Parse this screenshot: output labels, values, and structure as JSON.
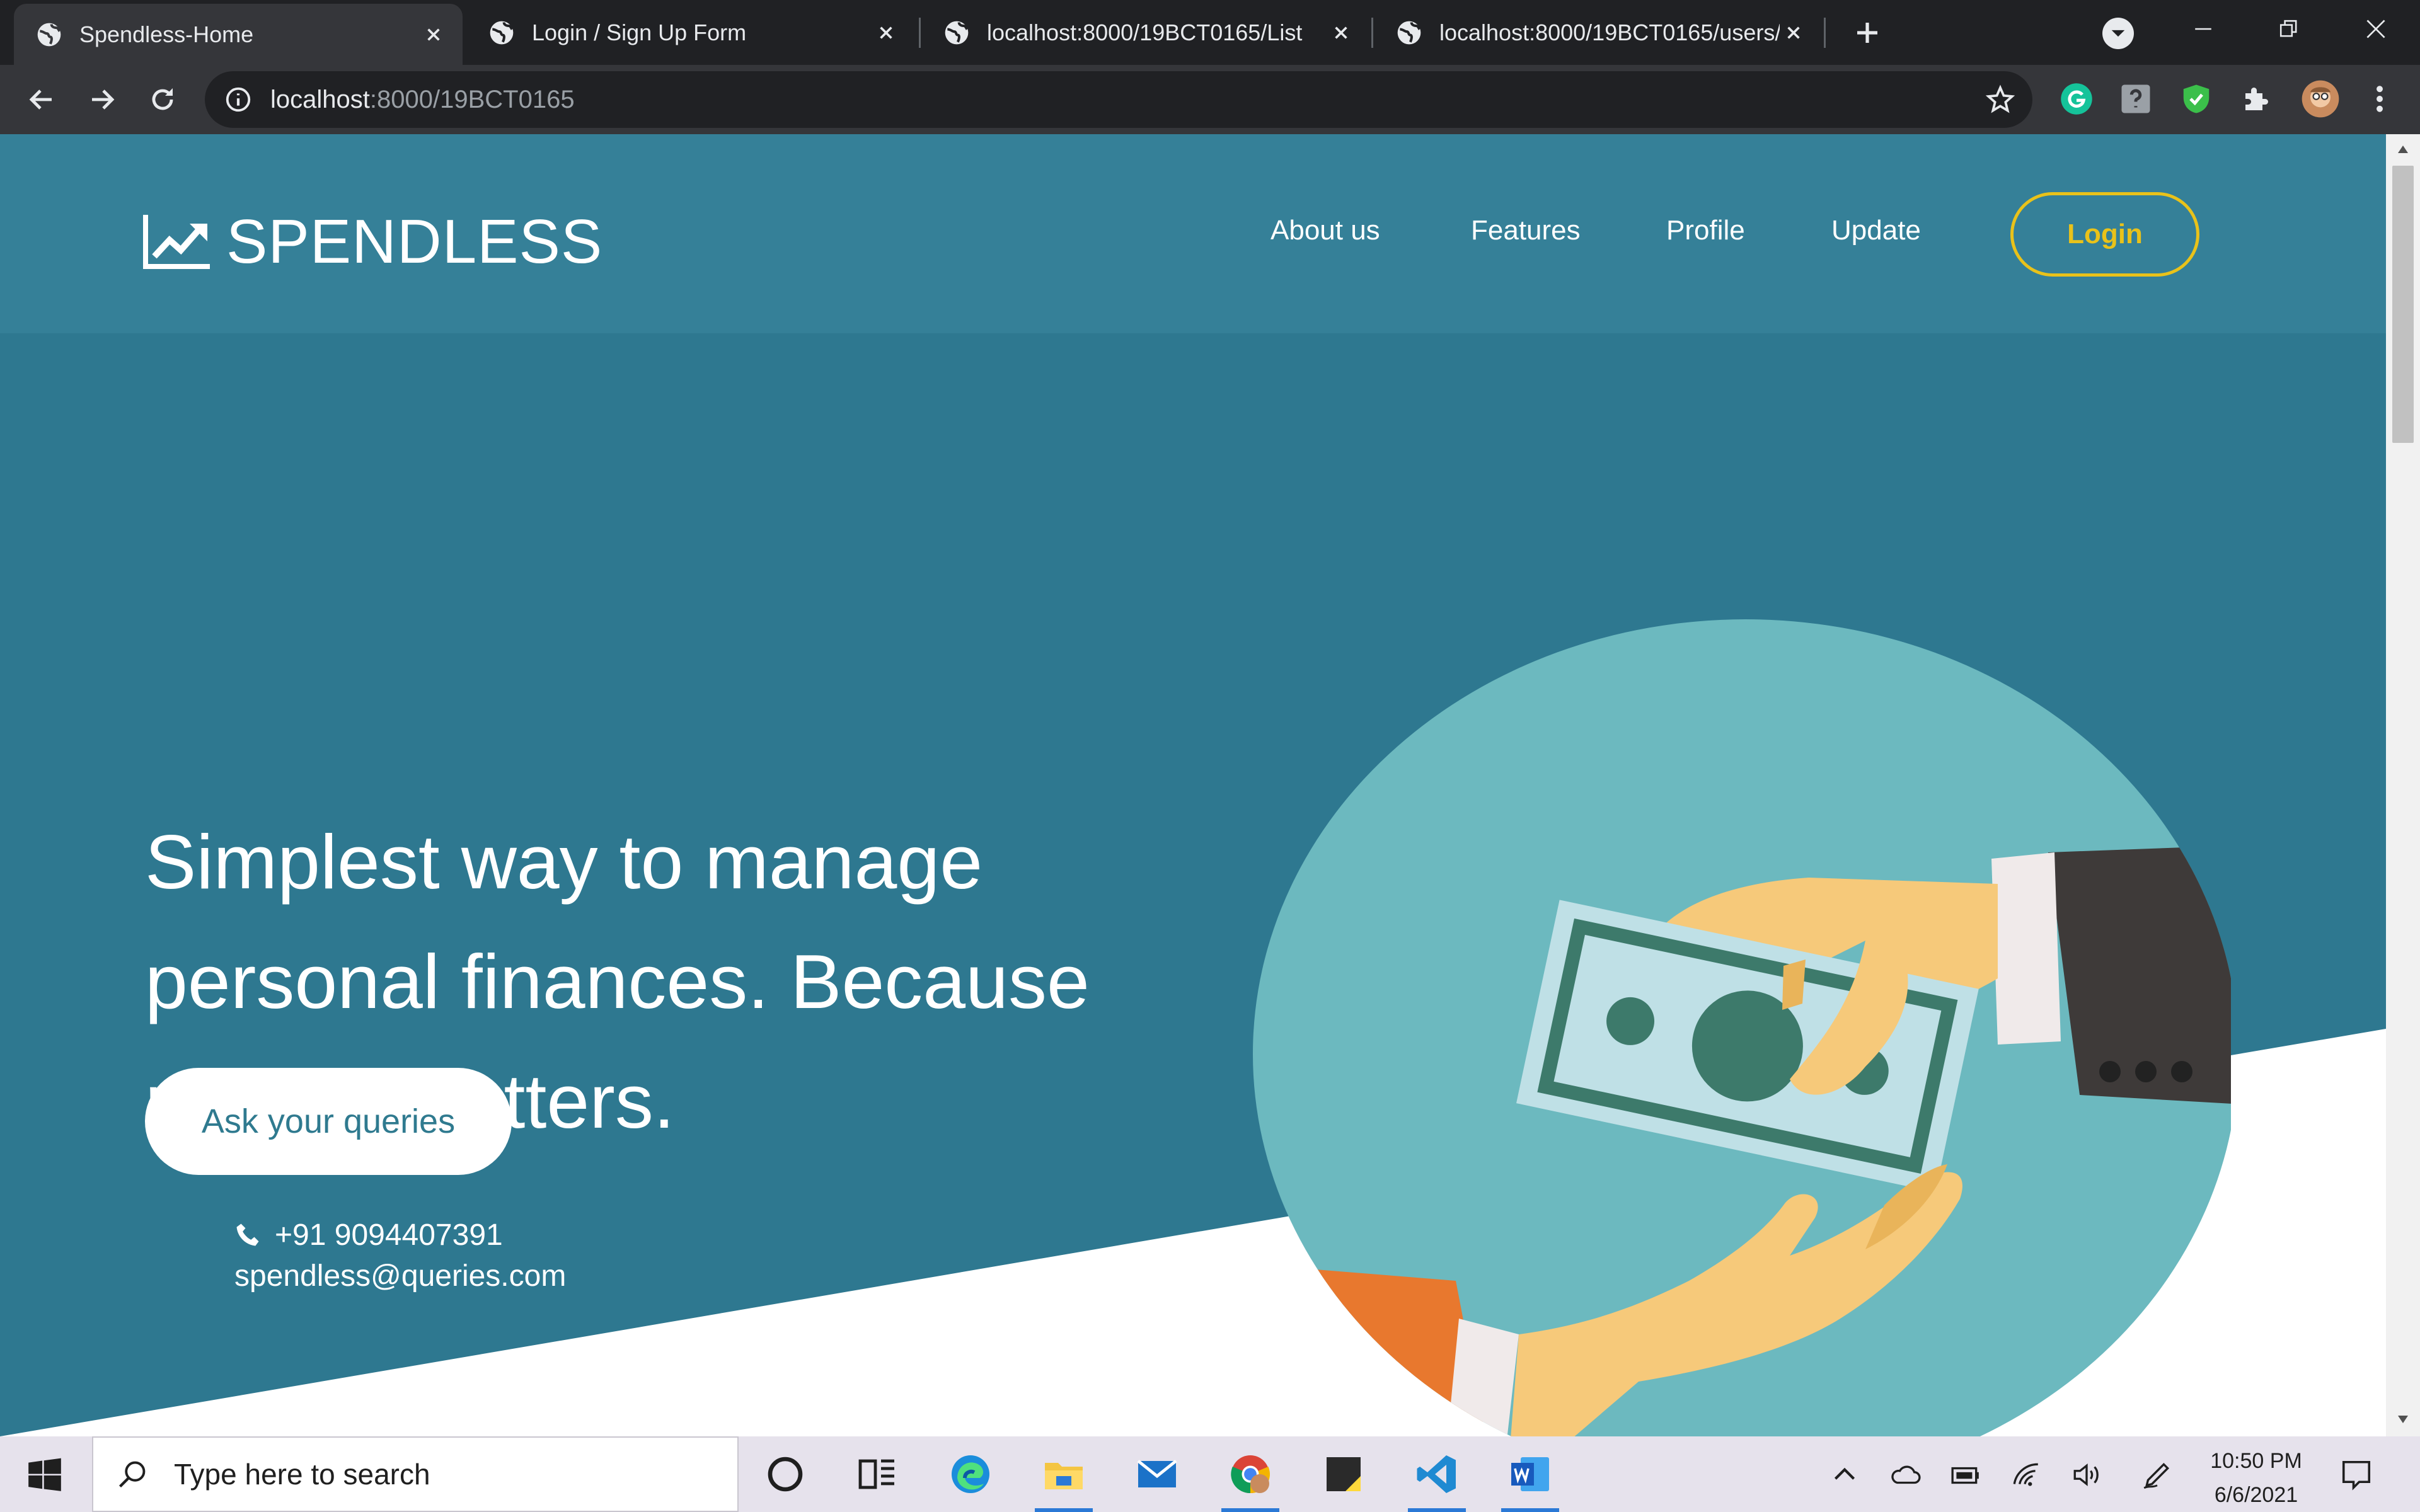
{
  "browser": {
    "tabs": [
      {
        "title": "Spendless-Home",
        "active": true
      },
      {
        "title": "Login / Sign Up Form",
        "active": false
      },
      {
        "title": "localhost:8000/19BCT0165/List",
        "active": false
      },
      {
        "title": "localhost:8000/19BCT0165/users/",
        "active": false
      }
    ],
    "url_host": "localhost",
    "url_path": ":8000/19BCT0165",
    "icons": [
      "back-icon",
      "forward-icon",
      "reload-icon",
      "info-icon",
      "star-icon",
      "grammarly-icon",
      "help-extension-icon",
      "shield-extension-icon",
      "puzzle-icon",
      "profile-avatar-icon",
      "kebab-menu-icon"
    ]
  },
  "site": {
    "brand": "SPENDLESS",
    "nav": {
      "about": "About us",
      "features": "Features",
      "profile": "Profile",
      "update": "Update",
      "login": "Login"
    },
    "hero": {
      "headline": "Simplest way to manage personal finances. Because money matters.",
      "cta": "Ask your queries",
      "phone": "+91 9094407391",
      "email": "spendless@queries.com"
    },
    "colors": {
      "navbar": "#358098",
      "hero": "#2e7890",
      "accent": "#e9c21a",
      "circle": "#6cb9bf"
    }
  },
  "taskbar": {
    "search_placeholder": "Type here to search",
    "time": "10:50 PM",
    "date": "6/6/2021"
  }
}
